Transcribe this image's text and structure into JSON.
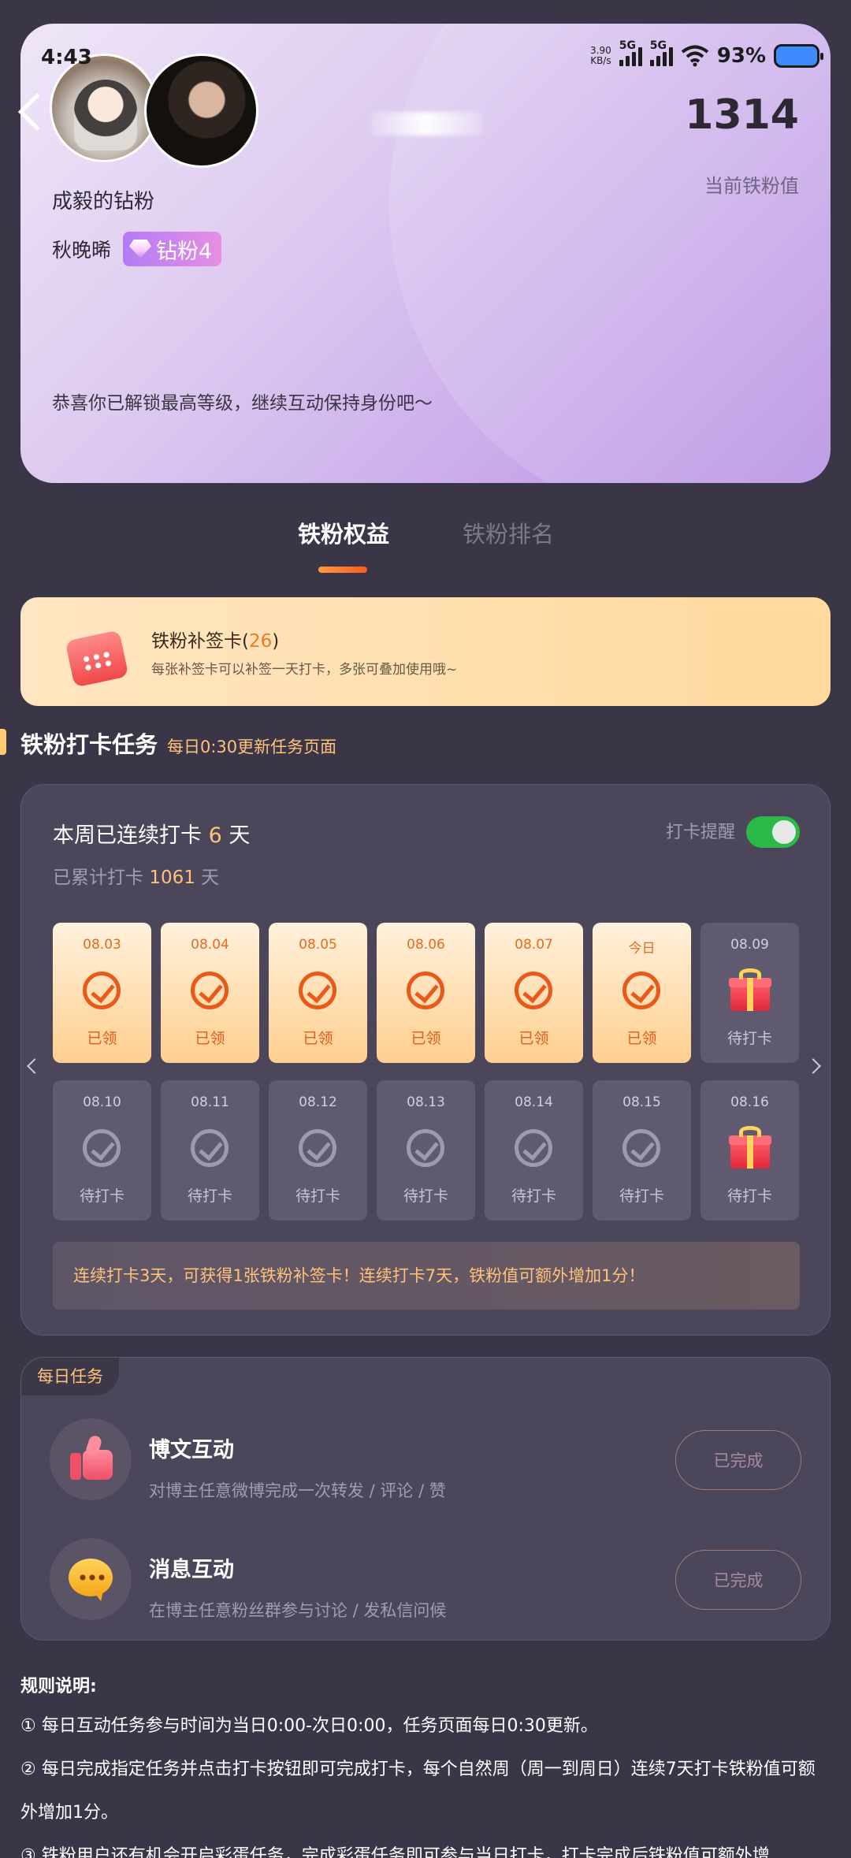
{
  "status_bar": {
    "time": "4:43",
    "net_speed_value": "3.90",
    "net_speed_unit": "KB/s",
    "signal_1": "5G",
    "signal_2": "5G",
    "battery": "93%"
  },
  "hero": {
    "score": "1314",
    "score_label": "当前铁粉值",
    "fan_title": "成毅的钻粉",
    "user_name": "秋晚晞",
    "badge": "钻粉4",
    "congrats": "恭喜你已解锁最高等级，继续互动保持身份吧～"
  },
  "tabs": [
    {
      "label": "铁粉权益",
      "active": true
    },
    {
      "label": "铁粉排名",
      "active": false
    }
  ],
  "sign_card": {
    "title": "铁粉补签卡(",
    "count": "26",
    "title_end": ")",
    "subtitle": "每张补签卡可以补签一天打卡，多张可叠加使用哦~"
  },
  "section": {
    "title": "铁粉打卡任务",
    "subtitle": "每日0:30更新任务页面"
  },
  "checkin": {
    "streak_prefix": "本周已连续打卡",
    "streak_days": "6",
    "streak_suffix": "天",
    "total_prefix": "已累计打卡",
    "total_days": "1061",
    "total_suffix": "天",
    "reminder_label": "打卡提醒",
    "reminder_on": true,
    "days": [
      {
        "date": "08.03",
        "status": "已领",
        "state": "claimed"
      },
      {
        "date": "08.04",
        "status": "已领",
        "state": "claimed"
      },
      {
        "date": "08.05",
        "status": "已领",
        "state": "claimed"
      },
      {
        "date": "08.06",
        "status": "已领",
        "state": "claimed"
      },
      {
        "date": "08.07",
        "status": "已领",
        "state": "claimed"
      },
      {
        "date": "今日",
        "status": "已领",
        "state": "claimed"
      },
      {
        "date": "08.09",
        "status": "待打卡",
        "state": "gift"
      },
      {
        "date": "08.10",
        "status": "待打卡",
        "state": "pending"
      },
      {
        "date": "08.11",
        "status": "待打卡",
        "state": "pending"
      },
      {
        "date": "08.12",
        "status": "待打卡",
        "state": "pending"
      },
      {
        "date": "08.13",
        "status": "待打卡",
        "state": "pending"
      },
      {
        "date": "08.14",
        "status": "待打卡",
        "state": "pending"
      },
      {
        "date": "08.15",
        "status": "待打卡",
        "state": "pending"
      },
      {
        "date": "08.16",
        "status": "待打卡",
        "state": "gift"
      }
    ],
    "tip": "连续打卡3天，可获得1张铁粉补签卡！连续打卡7天，铁粉值可额外增加1分！"
  },
  "daily_tasks": {
    "tag": "每日任务",
    "items": [
      {
        "title": "博文互动",
        "desc": "对博主任意微博完成一次转发 / 评论 / 赞",
        "button": "已完成",
        "icon": "thumbs-up-icon"
      },
      {
        "title": "消息互动",
        "desc": "在博主任意粉丝群参与讨论 / 发私信问候",
        "button": "已完成",
        "icon": "chat-bubble-icon"
      }
    ]
  },
  "rules": {
    "title": "规则说明:",
    "items": [
      "① 每日互动任务参与时间为当日0:00-次日0:00，任务页面每日0:30更新。",
      "② 每日完成指定任务并点击打卡按钮即可完成打卡，每个自然周（周一到周日）连续7天打卡铁粉值可额外增加1分。",
      "③ 铁粉用户还有机会开启彩蛋任务，完成彩蛋任务即可参与当日打卡，打卡完成后铁粉值可额外增"
    ]
  },
  "colors": {
    "background": "#3a3647",
    "accent": "#ffc27a",
    "claimed": "#e8591a",
    "toggle_on": "#2db84a"
  }
}
